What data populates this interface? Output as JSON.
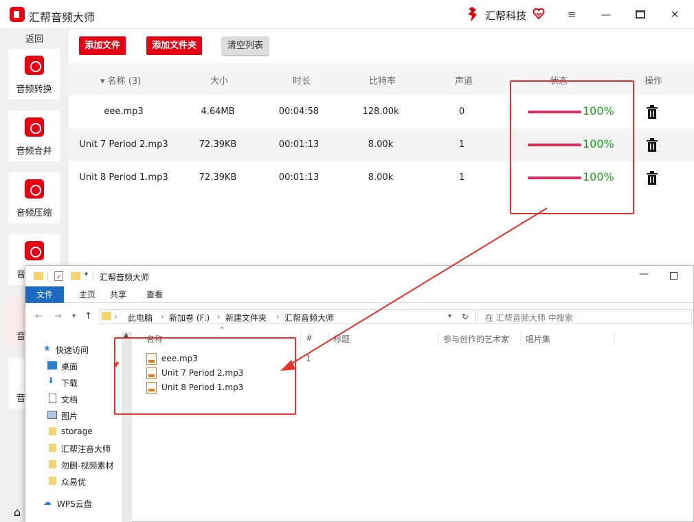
{
  "app": {
    "title": "汇帮音频大师",
    "brand": "汇帮科技"
  },
  "toolbar": {
    "add_file": "添加文件",
    "add_folder": "添加文件夹",
    "clear_list": "清空列表"
  },
  "sidebar": {
    "back": "返回",
    "items": [
      {
        "label": "音频转换",
        "icon": "audio-convert-icon"
      },
      {
        "label": "音频合并",
        "icon": "audio-merge-icon"
      },
      {
        "label": "音频压缩",
        "icon": "audio-compress-icon"
      },
      {
        "label": "音",
        "icon": "audio-icon"
      },
      {
        "label": "音"
      },
      {
        "label": "音"
      }
    ]
  },
  "table": {
    "headers": {
      "name": "名称 (3)",
      "size": "大小",
      "duration": "时长",
      "bitrate": "比特率",
      "channels": "声道",
      "status": "状态",
      "actions": "操作"
    },
    "rows": [
      {
        "name": "eee.mp3",
        "size": "4.64MB",
        "duration": "00:04:58",
        "bitrate": "128.00k",
        "channels": "0",
        "progress": 100,
        "progress_text": "100%"
      },
      {
        "name": "Unit 7 Period 2.mp3",
        "size": "72.39KB",
        "duration": "00:01:13",
        "bitrate": "8.00k",
        "channels": "1",
        "progress": 100,
        "progress_text": "100%"
      },
      {
        "name": "Unit 8 Period 1.mp3",
        "size": "72.39KB",
        "duration": "00:01:13",
        "bitrate": "8.00k",
        "channels": "1",
        "progress": 100,
        "progress_text": "100%"
      }
    ]
  },
  "explorer": {
    "title": "汇帮音频大师",
    "tabs": [
      "文件",
      "主页",
      "共享",
      "查看"
    ],
    "breadcrumbs": [
      "此电脑",
      "新加卷 (F:)",
      "新建文件夹",
      "汇帮音频大师"
    ],
    "search_placeholder": "在 汇帮音频大师 中搜索",
    "nav": [
      "快速访问",
      "桌面",
      "下载",
      "文档",
      "图片",
      "storage",
      "汇帮注音大师",
      "勿删-视频素材",
      "众易优",
      "WPS云盘"
    ],
    "columns": [
      "名称",
      "#",
      "标题",
      "参与创作的艺术家",
      "唱片集"
    ],
    "files": [
      "eee.mp3",
      "Unit 7 Period 2.mp3",
      "Unit 8 Period 1.mp3"
    ],
    "first_track_number": "1"
  },
  "colors": {
    "accent": "#e60012",
    "progress": "#e02a5c",
    "percent": "#1f9d1f",
    "annotation": "#e8302a",
    "explorer_tab": "#1a6bc1"
  }
}
